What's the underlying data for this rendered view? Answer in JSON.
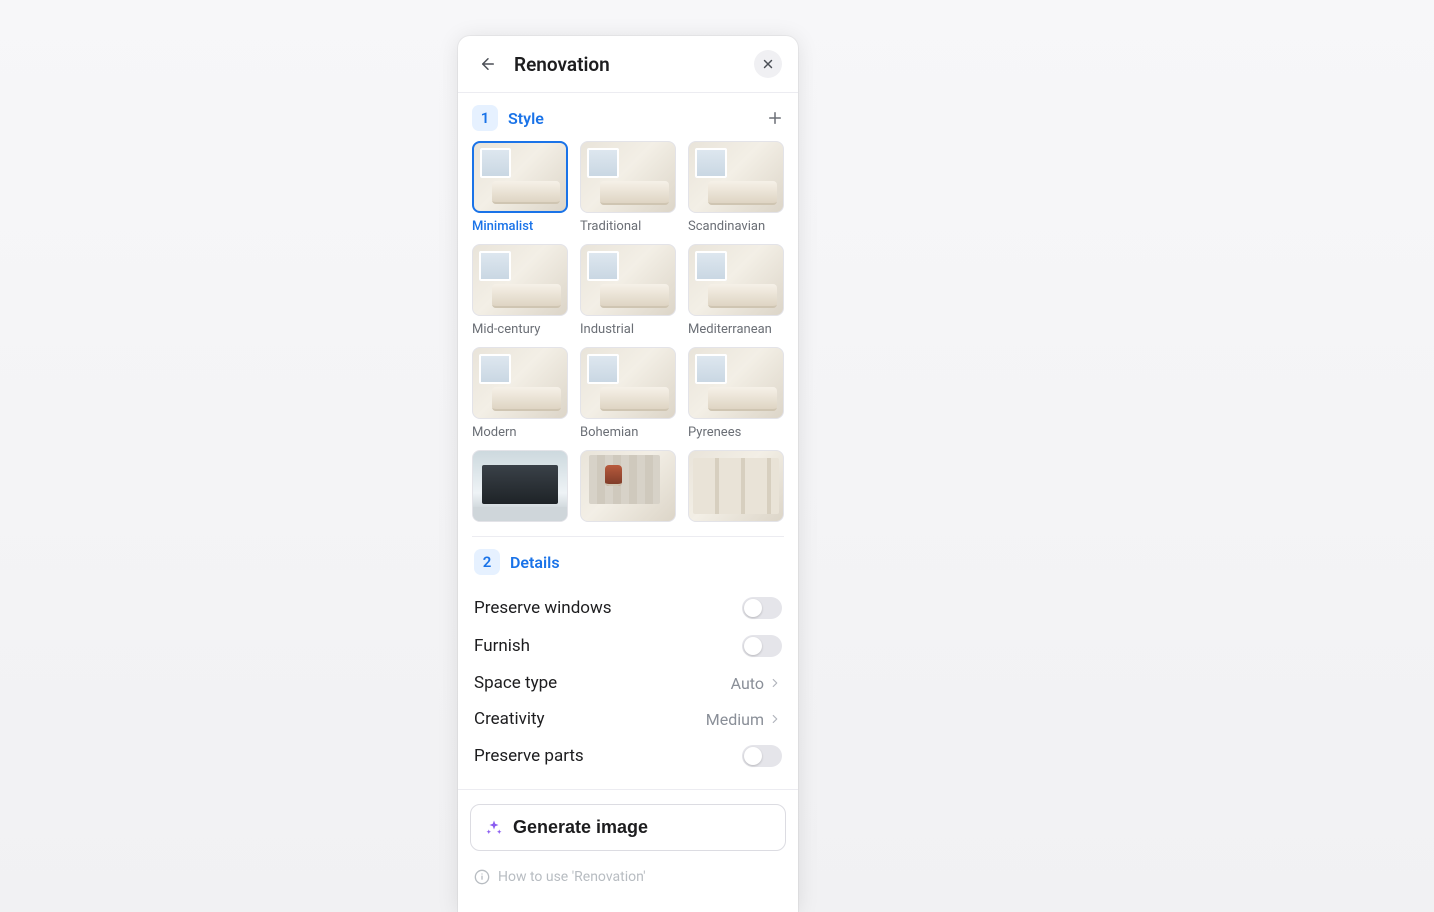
{
  "header": {
    "title": "Renovation"
  },
  "style_section": {
    "step": "1",
    "title": "Style",
    "selected_index": 0,
    "items": [
      {
        "label": "Minimalist",
        "thumb_class": "room"
      },
      {
        "label": "Traditional",
        "thumb_class": "room"
      },
      {
        "label": "Scandinavian",
        "thumb_class": "room"
      },
      {
        "label": "Mid-century",
        "thumb_class": "room"
      },
      {
        "label": "Industrial",
        "thumb_class": "room"
      },
      {
        "label": "Mediterranean",
        "thumb_class": "room"
      },
      {
        "label": "Modern",
        "thumb_class": "room"
      },
      {
        "label": "Bohemian",
        "thumb_class": "room"
      },
      {
        "label": "Pyrenees",
        "thumb_class": "room"
      },
      {
        "label": "",
        "thumb_class": "modern-house"
      },
      {
        "label": "",
        "thumb_class": "loft-interior"
      },
      {
        "label": "",
        "thumb_class": "shop"
      }
    ]
  },
  "details_section": {
    "step": "2",
    "title": "Details",
    "rows": {
      "preserve_windows": {
        "label": "Preserve windows",
        "value": false
      },
      "furnish": {
        "label": "Furnish",
        "value": false
      },
      "space_type": {
        "label": "Space type",
        "value": "Auto"
      },
      "creativity": {
        "label": "Creativity",
        "value": "Medium"
      },
      "preserve_parts": {
        "label": "Preserve parts",
        "value": false
      }
    }
  },
  "generate": {
    "label": "Generate image"
  },
  "footer_hint": "How to use 'Renovation'"
}
